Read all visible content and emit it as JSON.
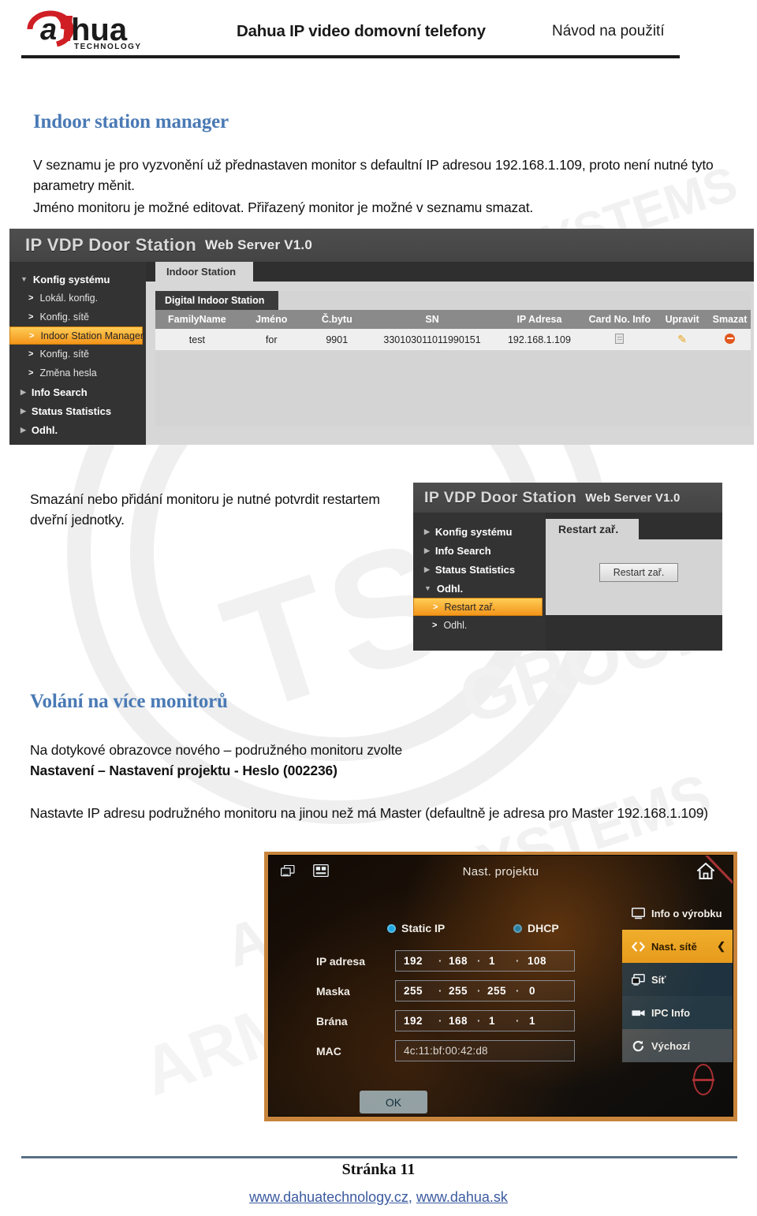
{
  "header": {
    "logo_alt": "dahua TECHNOLOGY",
    "logo_word": "hua",
    "logo_tagline": "TECHNOLOGY",
    "title": "Dahua IP video domovní telefony",
    "subtitle": "Návod na použití"
  },
  "sections": {
    "indoor": {
      "title": "Indoor station manager",
      "paragraph_1": "V seznamu je pro vyzvonění už přednastaven monitor s defaultní IP adresou 192.168.1.109, proto není nutné tyto parametry měnit.",
      "paragraph_2": "Jméno monitoru je možné editovat. Přiřazený monitor je možné v seznamu smazat."
    },
    "restart_note": "Smazání nebo přidání monitoru je nutné potvrdit restartem dveřní jednotky.",
    "multi": {
      "title": "Volání na více monitorů",
      "line_1": "Na dotykové obrazovce nového – podružného monitoru zvolte",
      "line_2_bold": "Nastavení – Nastavení projektu - Heslo (002236)",
      "line_3": "Nastavte IP adresu podružného monitoru na jinou než má Master (defaultně je adresa pro Master 192.168.1.109)"
    }
  },
  "shot_indoor": {
    "brand": "IP VDP Door Station",
    "version": "Web Server V1.0",
    "nav": [
      {
        "label": "Konfig systému",
        "level": 1,
        "marker": "caret-down",
        "selected": false
      },
      {
        "label": "Lokál. konfig.",
        "level": 2,
        "marker": "chevron-right",
        "selected": false
      },
      {
        "label": "Konfig. sítě",
        "level": 2,
        "marker": "chevron-right",
        "selected": false
      },
      {
        "label": "Indoor Station Manager",
        "level": 2,
        "marker": "chevron-right",
        "selected": true
      },
      {
        "label": "Konfig. sítě",
        "level": 2,
        "marker": "chevron-right",
        "selected": false
      },
      {
        "label": "Změna hesla",
        "level": 2,
        "marker": "chevron-right",
        "selected": false
      },
      {
        "label": "Info Search",
        "level": 1,
        "marker": "caret-right",
        "selected": false
      },
      {
        "label": "Status Statistics",
        "level": 1,
        "marker": "caret-right",
        "selected": false
      },
      {
        "label": "Odhl.",
        "level": 1,
        "marker": "caret-right",
        "selected": false
      }
    ],
    "tab": "Indoor Station",
    "panel_title": "Digital Indoor Station",
    "columns": [
      "FamilyName",
      "Jméno",
      "Č.bytu",
      "SN",
      "IP Adresa",
      "Card No. Info",
      "Upravit",
      "Smazat"
    ],
    "rows": [
      {
        "family_name": "test",
        "jmeno": "for",
        "c_bytu": "9901",
        "sn": "330103011011990151",
        "ip_adresa": "192.168.1.109",
        "card_icon": "document-icon",
        "edit_icon": "pencil-icon",
        "delete_icon": "delete-circle-icon"
      }
    ]
  },
  "shot_restart": {
    "brand": "IP VDP Door Station",
    "version": "Web Server V1.0",
    "nav": [
      {
        "label": "Konfig systému",
        "level": 1,
        "marker": "caret-right",
        "selected": false
      },
      {
        "label": "Info Search",
        "level": 1,
        "marker": "caret-right",
        "selected": false
      },
      {
        "label": "Status Statistics",
        "level": 1,
        "marker": "caret-right",
        "selected": false
      },
      {
        "label": "Odhl.",
        "level": 1,
        "marker": "caret-down",
        "selected": false
      },
      {
        "label": "Restart zař.",
        "level": 2,
        "marker": "chevron-right",
        "selected": true
      },
      {
        "label": "Odhl.",
        "level": 2,
        "marker": "chevron-right",
        "selected": false
      }
    ],
    "tab": "Restart zař.",
    "button": "Restart zař."
  },
  "photo": {
    "title": "Nast. projektu",
    "icons": {
      "multi_screen": "multi-screen-icon",
      "sd_card": "sd-card-icon",
      "home": "home-icon"
    },
    "ip_mode": {
      "static_label": "Static IP",
      "dhcp_label": "DHCP",
      "selected": "Static IP"
    },
    "fields": [
      {
        "label": "IP adresa",
        "value": [
          "192",
          "168",
          "1",
          "108"
        ],
        "type": "ip"
      },
      {
        "label": "Maska",
        "value": [
          "255",
          "255",
          "255",
          "0"
        ],
        "type": "ip"
      },
      {
        "label": "Brána",
        "value": [
          "192",
          "168",
          "1",
          "1"
        ],
        "type": "ip"
      },
      {
        "label": "MAC",
        "value": "4c:11:bf:00:42:d8",
        "type": "text"
      }
    ],
    "ok_button": "OK",
    "side_menu": [
      {
        "label": "Info o výrobku",
        "icon": "monitor-icon",
        "selected": false
      },
      {
        "label": "Nast. sítě",
        "icon": "code-brackets-icon",
        "selected": true
      },
      {
        "label": "Síť",
        "icon": "network-icon",
        "selected": false
      },
      {
        "label": "IPC Info",
        "icon": "camera-icon",
        "selected": false
      },
      {
        "label": "Výchozí",
        "icon": "restore-icon",
        "selected": false
      }
    ]
  },
  "footer": {
    "page": "Stránka 11",
    "link_1": "www.dahuatechnology.cz",
    "separator": ", ",
    "link_2": "www.dahua.sk"
  },
  "colors": {
    "heading_blue": "#4a7ab5",
    "accent_orange": "#f3951a",
    "link_blue": "#3b5aa0",
    "footer_rule": "#5a6f86"
  }
}
